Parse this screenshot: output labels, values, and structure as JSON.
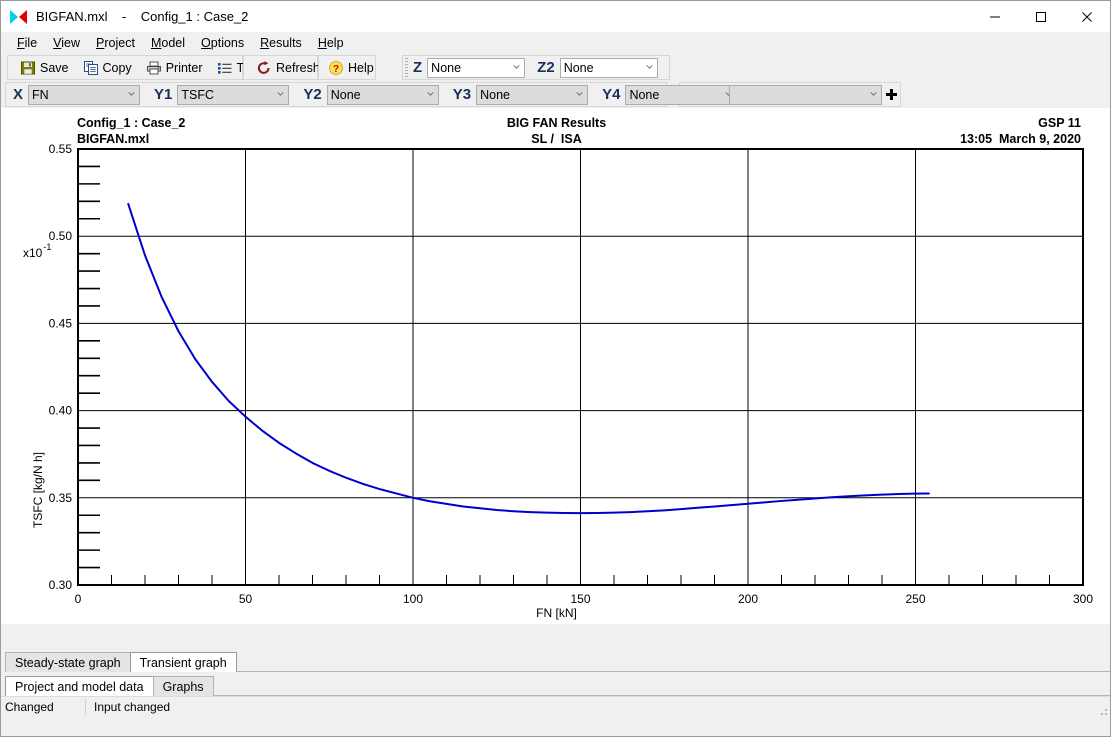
{
  "window": {
    "icon": "bigfan-icon",
    "title": "BIGFAN.mxl    -    Config_1 : Case_2",
    "minimize": "—",
    "maximize": "□",
    "close": "✕"
  },
  "menu": {
    "items": [
      {
        "label": "File",
        "accel": "F"
      },
      {
        "label": "View",
        "accel": "V"
      },
      {
        "label": "Project",
        "accel": "P"
      },
      {
        "label": "Model",
        "accel": "M"
      },
      {
        "label": "Options",
        "accel": "O"
      },
      {
        "label": "Results",
        "accel": "R"
      },
      {
        "label": "Help",
        "accel": "H"
      }
    ]
  },
  "toolbar": {
    "save_label": "Save",
    "copy_label": "Copy",
    "printer_label": "Printer",
    "tools_label": "Tools",
    "refresh_label": "Refresh",
    "help_label": "Help"
  },
  "selectors": {
    "x": {
      "label": "X",
      "value": "FN"
    },
    "y1": {
      "label": "Y1",
      "value": "TSFC"
    },
    "y2": {
      "label": "Y2",
      "value": "None"
    },
    "y3": {
      "label": "Y3",
      "value": "None"
    },
    "y4": {
      "label": "Y4",
      "value": "None"
    },
    "z": {
      "label": "Z",
      "value": "None"
    },
    "z2": {
      "label": "Z2",
      "value": "None"
    },
    "graph": {
      "label": "Graph",
      "value": "",
      "add_button": "+"
    }
  },
  "chart_header": {
    "left_line1": "Config_1 : Case_2",
    "left_line2": "BIGFAN.mxl",
    "center_line1": "BIG FAN Results",
    "center_line2": "SL /  ISA",
    "right_line1": "GSP 11",
    "right_line2": "13:05  March 9, 2020",
    "exponent_base": "x10",
    "exponent_power": "-1"
  },
  "chart_data": {
    "type": "line",
    "title": "BIG FAN Results",
    "subtitle": "SL /  ISA",
    "xlabel": "FN [kN]",
    "ylabel": "TSFC [kg/N h]",
    "xlim": [
      0,
      300
    ],
    "ylim": [
      0.3,
      0.55
    ],
    "y_scale_exponent": -1,
    "xticks": [
      0,
      50,
      100,
      150,
      200,
      250,
      300
    ],
    "xtick_labels": [
      "0",
      "50",
      "100",
      "150",
      "200",
      "250",
      "300"
    ],
    "x_minor_interval": 10,
    "yticks": [
      0.3,
      0.35,
      0.4,
      0.45,
      0.5,
      0.55
    ],
    "ytick_labels": [
      "0.30",
      "0.35",
      "0.40",
      "0.45",
      "0.50",
      "0.55"
    ],
    "y_minor_interval": 0.01,
    "grid": true,
    "legend": null,
    "series": [
      {
        "name": "TSFC",
        "color": "#0000cc",
        "line_width": 2,
        "x": [
          15,
          20,
          25,
          30,
          35,
          40,
          45,
          50,
          55,
          60,
          65,
          70,
          75,
          80,
          85,
          90,
          95,
          100,
          105,
          110,
          115,
          120,
          125,
          130,
          135,
          140,
          145,
          150,
          155,
          160,
          165,
          170,
          175,
          180,
          185,
          190,
          195,
          200,
          205,
          210,
          215,
          220,
          225,
          230,
          235,
          240,
          245,
          250,
          254
        ],
        "y": [
          0.5185,
          0.489,
          0.465,
          0.4455,
          0.4295,
          0.4165,
          0.4055,
          0.3965,
          0.3885,
          0.3815,
          0.3755,
          0.37,
          0.3655,
          0.3615,
          0.358,
          0.355,
          0.3525,
          0.35,
          0.348,
          0.3465,
          0.345,
          0.344,
          0.343,
          0.3423,
          0.3418,
          0.3415,
          0.3413,
          0.3412,
          0.3413,
          0.3415,
          0.3418,
          0.3423,
          0.3428,
          0.3435,
          0.3443,
          0.345,
          0.3458,
          0.3466,
          0.3474,
          0.3482,
          0.3489,
          0.3496,
          0.3503,
          0.3509,
          0.3514,
          0.3518,
          0.3522,
          0.3524,
          0.3525
        ]
      }
    ]
  },
  "tabs_upper": [
    {
      "label": "Steady-state graph",
      "active": false
    },
    {
      "label": "Transient graph",
      "active": true
    }
  ],
  "tabs_lower": [
    {
      "label": "Project and model data",
      "active": true
    },
    {
      "label": "Graphs",
      "active": false
    }
  ],
  "statusbar": {
    "pane1": "Changed",
    "pane2": "Input changed"
  }
}
